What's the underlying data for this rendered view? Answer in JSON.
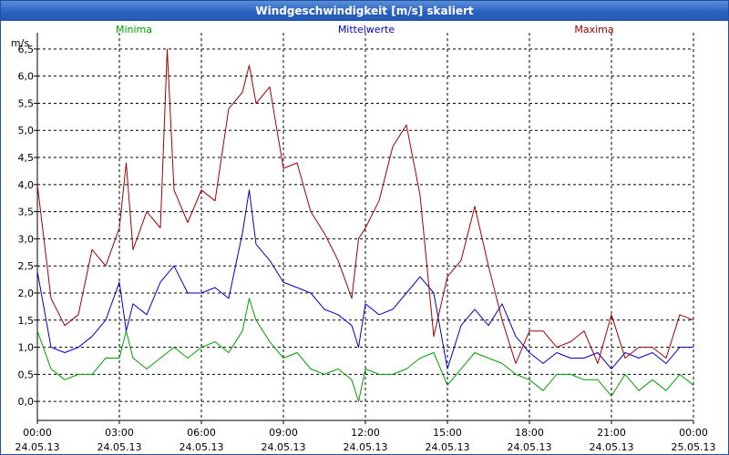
{
  "window": {
    "title": "Windgeschwindigkeit [m/s] skaliert"
  },
  "colors": {
    "minima": "#00a000",
    "mittelwerte": "#0000c8",
    "maxima": "#a00000",
    "grid": "#000000"
  },
  "chart_data": {
    "type": "line",
    "ylabel": "m/s",
    "ylim": [
      -0.35,
      6.8
    ],
    "y_ticks": [
      "0,0",
      "0,5",
      "1,0",
      "1,5",
      "2,0",
      "2,5",
      "3,0",
      "3,5",
      "4,0",
      "4,5",
      "5,0",
      "5,5",
      "6,0",
      "6,5"
    ],
    "y_tick_values": [
      0,
      0.5,
      1,
      1.5,
      2,
      2.5,
      3,
      3.5,
      4,
      4.5,
      5,
      5.5,
      6,
      6.5
    ],
    "x_ticks": [
      {
        "time": "00:00",
        "date": "24.05.13"
      },
      {
        "time": "03:00",
        "date": "24.05.13"
      },
      {
        "time": "06:00",
        "date": "24.05.13"
      },
      {
        "time": "09:00",
        "date": "24.05.13"
      },
      {
        "time": "12:00",
        "date": "24.05.13"
      },
      {
        "time": "15:00",
        "date": "24.05.13"
      },
      {
        "time": "18:00",
        "date": "24.05.13"
      },
      {
        "time": "21:00",
        "date": "24.05.13"
      },
      {
        "time": "00:00",
        "date": "25.05.13"
      }
    ],
    "x_unit": "hours from 24.05.13 00:00",
    "xlim": [
      0,
      24
    ],
    "legend": [
      "Minima",
      "Mittelwerte",
      "Maxima"
    ],
    "series": [
      {
        "name": "Minima",
        "x": [
          0,
          0.5,
          1,
          1.5,
          2,
          2.5,
          3,
          3.25,
          3.5,
          4,
          4.5,
          5,
          5.5,
          6,
          6.5,
          7,
          7.5,
          7.75,
          8,
          8.5,
          9,
          9.5,
          10,
          10.5,
          11,
          11.5,
          11.75,
          12,
          12.5,
          13,
          13.5,
          14,
          14.5,
          15,
          15.5,
          16,
          16.5,
          17,
          17.5,
          18,
          18.5,
          19,
          19.5,
          20,
          20.5,
          21,
          21.5,
          22,
          22.5,
          23,
          23.5,
          24
        ],
        "values": [
          1.3,
          0.6,
          0.4,
          0.5,
          0.5,
          0.8,
          0.8,
          1.3,
          0.8,
          0.6,
          0.8,
          1.0,
          0.8,
          1.0,
          1.1,
          0.9,
          1.3,
          1.9,
          1.5,
          1.1,
          0.8,
          0.9,
          0.6,
          0.5,
          0.6,
          0.4,
          0.0,
          0.6,
          0.5,
          0.5,
          0.6,
          0.8,
          0.9,
          0.3,
          0.6,
          0.9,
          0.8,
          0.7,
          0.5,
          0.4,
          0.2,
          0.5,
          0.5,
          0.4,
          0.4,
          0.1,
          0.5,
          0.2,
          0.4,
          0.2,
          0.5,
          0.3
        ]
      },
      {
        "name": "Mittelwerte",
        "x": [
          0,
          0.5,
          1,
          1.5,
          2,
          2.5,
          3,
          3.25,
          3.5,
          4,
          4.5,
          5,
          5.5,
          6,
          6.5,
          7,
          7.5,
          7.75,
          8,
          8.5,
          9,
          9.5,
          10,
          10.5,
          11,
          11.5,
          11.75,
          12,
          12.5,
          13,
          13.5,
          14,
          14.5,
          15,
          15.5,
          16,
          16.5,
          17,
          17.5,
          18,
          18.5,
          19,
          19.5,
          20,
          20.5,
          21,
          21.5,
          22,
          22.5,
          23,
          23.5,
          24
        ],
        "values": [
          2.4,
          1.0,
          0.9,
          1.0,
          1.2,
          1.5,
          2.2,
          1.3,
          1.8,
          1.6,
          2.2,
          2.5,
          2.0,
          2.0,
          2.1,
          1.9,
          3.1,
          3.9,
          2.9,
          2.6,
          2.2,
          2.1,
          2.0,
          1.7,
          1.6,
          1.4,
          1.0,
          1.8,
          1.6,
          1.7,
          2.0,
          2.3,
          2.0,
          0.6,
          1.4,
          1.7,
          1.4,
          1.8,
          1.2,
          0.9,
          0.7,
          0.9,
          0.8,
          0.8,
          0.9,
          0.6,
          0.9,
          0.8,
          0.9,
          0.7,
          1.0,
          1.0
        ]
      },
      {
        "name": "Maxima",
        "x": [
          0,
          0.5,
          1,
          1.5,
          2,
          2.5,
          3,
          3.25,
          3.5,
          4,
          4.5,
          4.75,
          5,
          5.5,
          6,
          6.5,
          7,
          7.5,
          7.75,
          8,
          8.5,
          9,
          9.5,
          10,
          10.5,
          11,
          11.5,
          11.75,
          12,
          12.5,
          13,
          13.5,
          14,
          14.5,
          15,
          15.5,
          16,
          16.5,
          17,
          17.5,
          18,
          18.5,
          19,
          19.5,
          20,
          20.5,
          21,
          21.5,
          22,
          22.5,
          23,
          23.5,
          24
        ],
        "values": [
          4.0,
          1.9,
          1.4,
          1.6,
          2.8,
          2.5,
          3.2,
          4.4,
          2.8,
          3.5,
          3.2,
          6.5,
          3.9,
          3.3,
          3.9,
          3.7,
          5.4,
          5.7,
          6.2,
          5.5,
          5.8,
          4.3,
          4.4,
          3.5,
          3.1,
          2.6,
          1.9,
          3.0,
          3.2,
          3.7,
          4.7,
          5.1,
          3.8,
          1.2,
          2.3,
          2.6,
          3.6,
          2.5,
          1.5,
          0.7,
          1.3,
          1.3,
          1.0,
          1.1,
          1.3,
          0.7,
          1.6,
          0.8,
          1.0,
          1.0,
          0.8,
          1.6,
          1.5
        ]
      }
    ]
  }
}
